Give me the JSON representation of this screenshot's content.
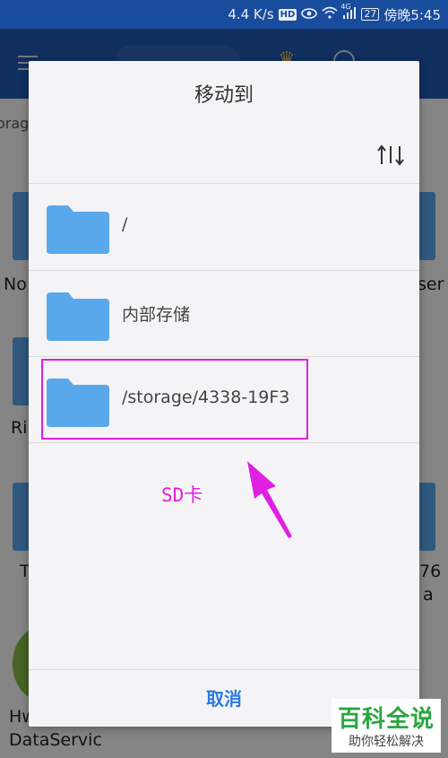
{
  "status_bar": {
    "net_speed": "4.4 K/s",
    "hd": "HD",
    "signal": "4G",
    "battery": "27",
    "time": "傍晚5:45"
  },
  "background": {
    "breadcrumb": "orag",
    "labels": [
      "No",
      "ser",
      "Ri",
      "T",
      "76",
      "a",
      "Hw",
      "DataServic"
    ]
  },
  "dialog": {
    "title": "移动到",
    "sort_icon": "sort-icon",
    "folders": [
      {
        "label": "/",
        "icon": "folder-icon"
      },
      {
        "label": "内部存储",
        "icon": "folder-icon"
      },
      {
        "label": "/storage/4338-19F3",
        "icon": "folder-icon"
      }
    ],
    "cancel_label": "取消"
  },
  "annotation": {
    "text": "SD卡",
    "color": "#e020e0"
  },
  "watermark": {
    "top": "百科全说",
    "bottom": "助你轻松解决"
  },
  "colors": {
    "status_bar": "#1a4c9e",
    "app_bar": "#1e56ad",
    "folder": "#5aa8ec",
    "accent": "#2a7be0",
    "watermark_green": "#2aa640"
  }
}
